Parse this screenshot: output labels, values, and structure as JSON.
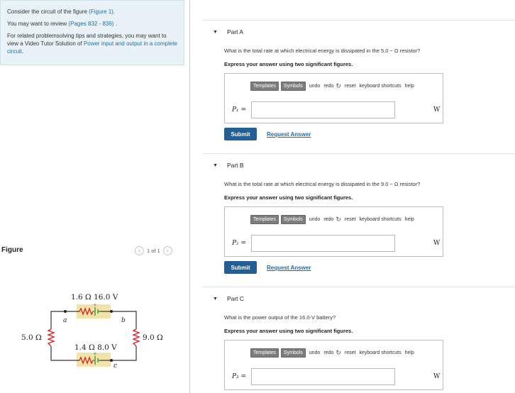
{
  "intro": {
    "line1_pre": "Consider the circuit of the figure ",
    "line1_link": "(Figure 1)",
    "line1_post": ".",
    "line2_pre": "You may want to review ",
    "line2_link": "(Pages 832 - 836)",
    "line2_post": " .",
    "line3_pre": "For related problemsolving tips and strategies, you may want to view a Video Tutor Solution of ",
    "line3_link": "Power input and output in a complete circuit",
    "line3_post": "."
  },
  "figure": {
    "label": "Figure",
    "pager_text": "1 of 1",
    "prev_icon": "chevron-left-icon",
    "next_icon": "chevron-right-icon"
  },
  "circuit": {
    "top_label": "1.6 Ω  16.0 V",
    "bottom_label": "1.4 Ω  8.0 V",
    "left_label": "5.0 Ω",
    "right_label": "9.0 Ω",
    "node_a": "a",
    "node_b": "b",
    "node_c": "c",
    "plus": "+",
    "resistor_color": "#d62020",
    "battery_color": "#3b9a3b",
    "highlight_color": "#f3e3a8"
  },
  "toolbar": {
    "templates": "Templates",
    "symbols": "Symbols",
    "undo": "undo",
    "redo": "redo",
    "reset": "reset",
    "shortcuts": "keyboard shortcuts",
    "help": "help"
  },
  "parts": [
    {
      "title": "Part A",
      "question": "What is the total rate at which electrical energy is dissipated in the 5.0 − Ω resistor?",
      "instruction": "Express your answer using two significant figures.",
      "var": "P₁ =",
      "unit": "W",
      "submit": "Submit",
      "request": "Request Answer"
    },
    {
      "title": "Part B",
      "question": "What is the total rate at which electrical energy is dissipated in the 9.0 − Ω resistor?",
      "instruction": "Express your answer using two significant figures.",
      "var": "P₂ =",
      "unit": "W",
      "submit": "Submit",
      "request": "Request Answer"
    },
    {
      "title": "Part C",
      "question": "What is the power output of the 16.0-V battery?",
      "instruction": "Express your answer using two significant figures.",
      "var": "P₃ =",
      "unit": "W"
    }
  ]
}
